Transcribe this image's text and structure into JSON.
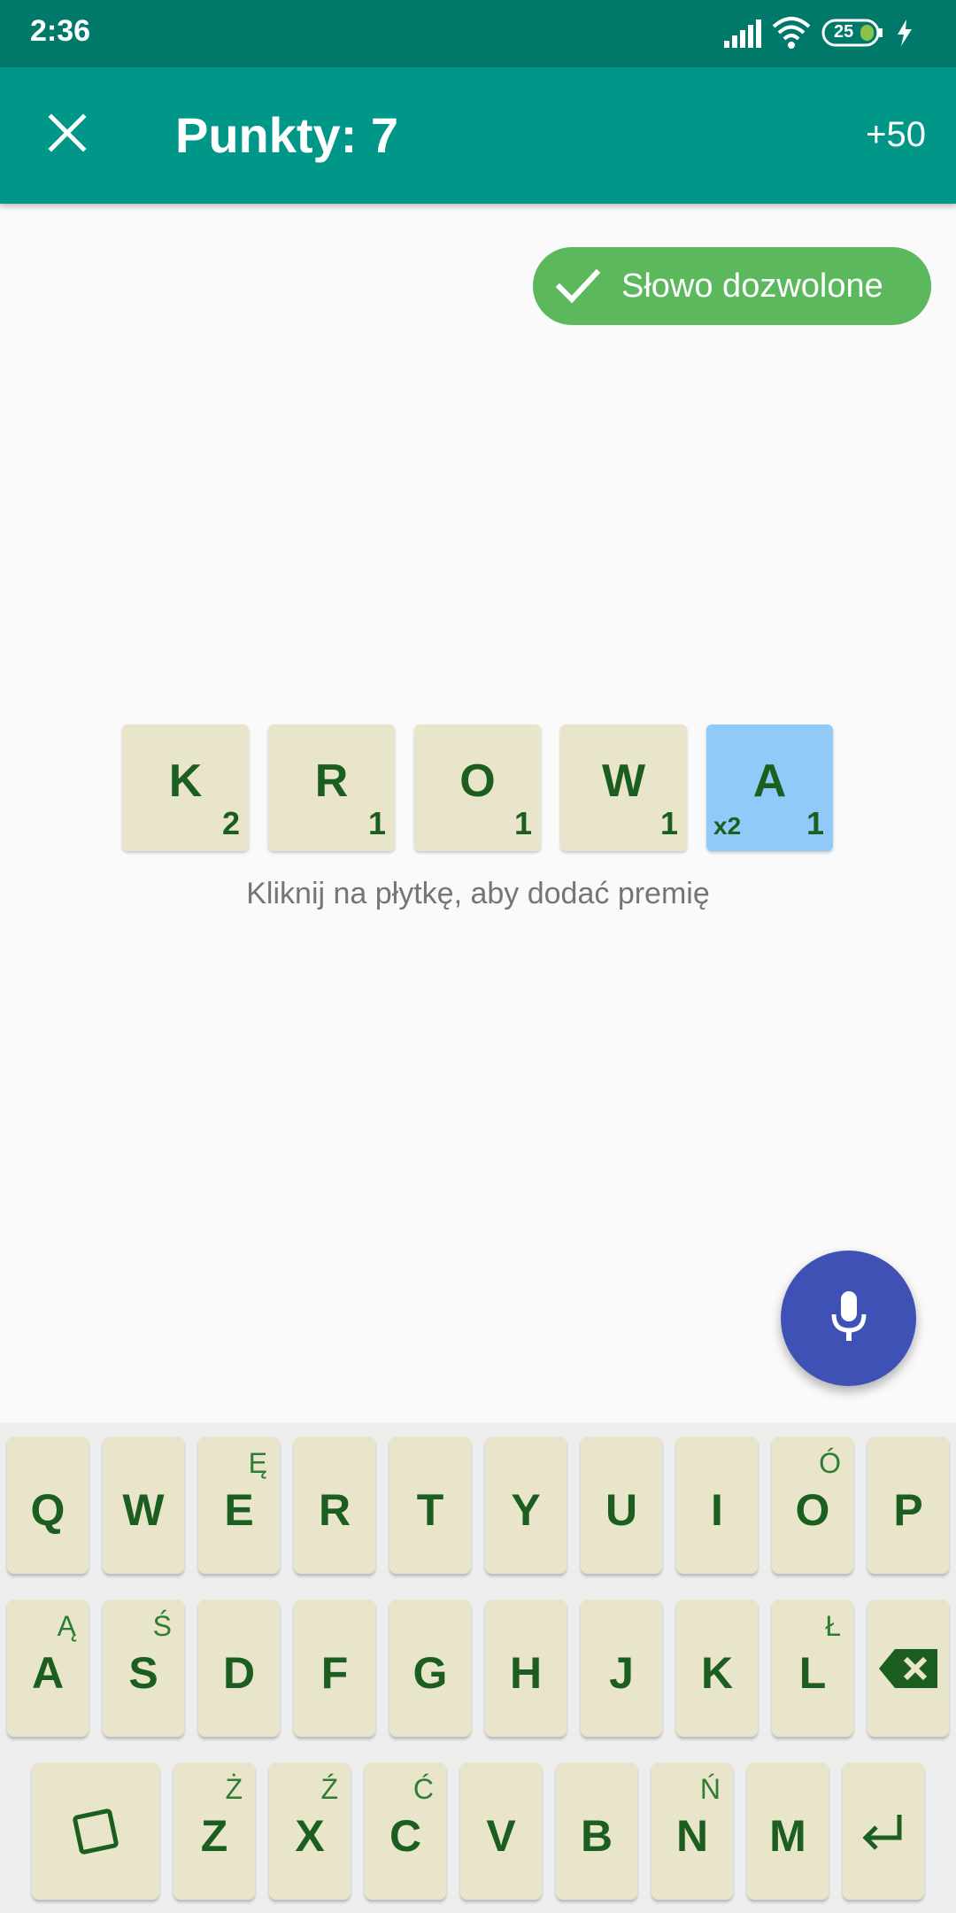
{
  "status_bar": {
    "time": "2:36",
    "battery": "25",
    "icons": [
      "signal-icon",
      "wifi-icon",
      "battery-icon",
      "charging-icon"
    ]
  },
  "app_bar": {
    "title": "Punkty: 7",
    "bonus_label": "+50",
    "close_icon": "close-icon"
  },
  "status_chip": {
    "label": "Słowo dozwolone",
    "icon": "check-icon",
    "color": "#5cb85c"
  },
  "tiles": [
    {
      "letter": "K",
      "points": "2",
      "multiplier": ""
    },
    {
      "letter": "R",
      "points": "1",
      "multiplier": ""
    },
    {
      "letter": "O",
      "points": "1",
      "multiplier": ""
    },
    {
      "letter": "W",
      "points": "1",
      "multiplier": ""
    },
    {
      "letter": "A",
      "points": "1",
      "multiplier": "x2"
    }
  ],
  "hint": "Kliknij na płytkę, aby dodać premię",
  "fab": {
    "icon": "microphone-icon",
    "color": "#3f51b5"
  },
  "keyboard": {
    "row1": [
      {
        "letter": "Q",
        "alt": ""
      },
      {
        "letter": "W",
        "alt": ""
      },
      {
        "letter": "E",
        "alt": "Ę"
      },
      {
        "letter": "R",
        "alt": ""
      },
      {
        "letter": "T",
        "alt": ""
      },
      {
        "letter": "Y",
        "alt": ""
      },
      {
        "letter": "U",
        "alt": ""
      },
      {
        "letter": "I",
        "alt": ""
      },
      {
        "letter": "O",
        "alt": "Ó"
      },
      {
        "letter": "P",
        "alt": ""
      }
    ],
    "row2": [
      {
        "letter": "A",
        "alt": "Ą"
      },
      {
        "letter": "S",
        "alt": "Ś"
      },
      {
        "letter": "D",
        "alt": ""
      },
      {
        "letter": "F",
        "alt": ""
      },
      {
        "letter": "G",
        "alt": ""
      },
      {
        "letter": "H",
        "alt": ""
      },
      {
        "letter": "J",
        "alt": ""
      },
      {
        "letter": "K",
        "alt": ""
      },
      {
        "letter": "L",
        "alt": "Ł"
      }
    ],
    "row3": [
      {
        "letter": "Z",
        "alt": "Ż"
      },
      {
        "letter": "X",
        "alt": "Ź"
      },
      {
        "letter": "C",
        "alt": "Ć"
      },
      {
        "letter": "V",
        "alt": ""
      },
      {
        "letter": "B",
        "alt": ""
      },
      {
        "letter": "N",
        "alt": "Ń"
      },
      {
        "letter": "M",
        "alt": ""
      }
    ],
    "icons": {
      "backspace": "backspace-icon",
      "blank": "blank-tile-icon",
      "enter": "enter-icon"
    },
    "key_color": "#e9e5cb",
    "text_color": "#1b5e20"
  }
}
